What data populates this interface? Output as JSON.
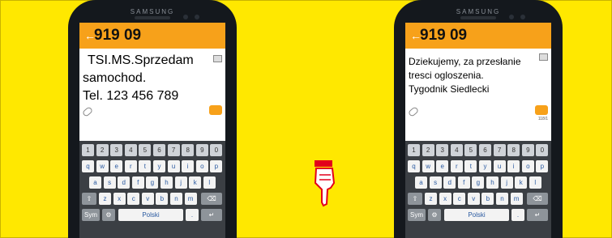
{
  "phones": [
    {
      "brand": "SAMSUNG",
      "header": {
        "back_icon": "arrow-left-icon",
        "number": "919 09"
      },
      "message_lines": [
        "TSI.MS.Sprzedam",
        "samochod.",
        "Tel. 123 456 789"
      ]
    },
    {
      "brand": "SAMSUNG",
      "header": {
        "back_icon": "arrow-left-icon",
        "number": "919 09"
      },
      "message_lines": [
        "Dziekujemy,  za przesłanie",
        "tresci ogloszenia.",
        "Tygodnik Siedlecki"
      ],
      "counter": "118/1"
    }
  ],
  "keyboard": {
    "row1": [
      "1",
      "2",
      "3",
      "4",
      "5",
      "6",
      "7",
      "8",
      "9",
      "0"
    ],
    "row2": [
      "q",
      "w",
      "e",
      "r",
      "t",
      "y",
      "u",
      "i",
      "o",
      "p"
    ],
    "row3": [
      "a",
      "s",
      "d",
      "f",
      "g",
      "h",
      "j",
      "k",
      "l"
    ],
    "row4": [
      "z",
      "x",
      "c",
      "v",
      "b",
      "n",
      "m"
    ],
    "sym": "Sym",
    "space": "Polski"
  },
  "colors": {
    "background": "#ffe800",
    "accent": "#f7a11a",
    "pointer": "#e3001b"
  }
}
